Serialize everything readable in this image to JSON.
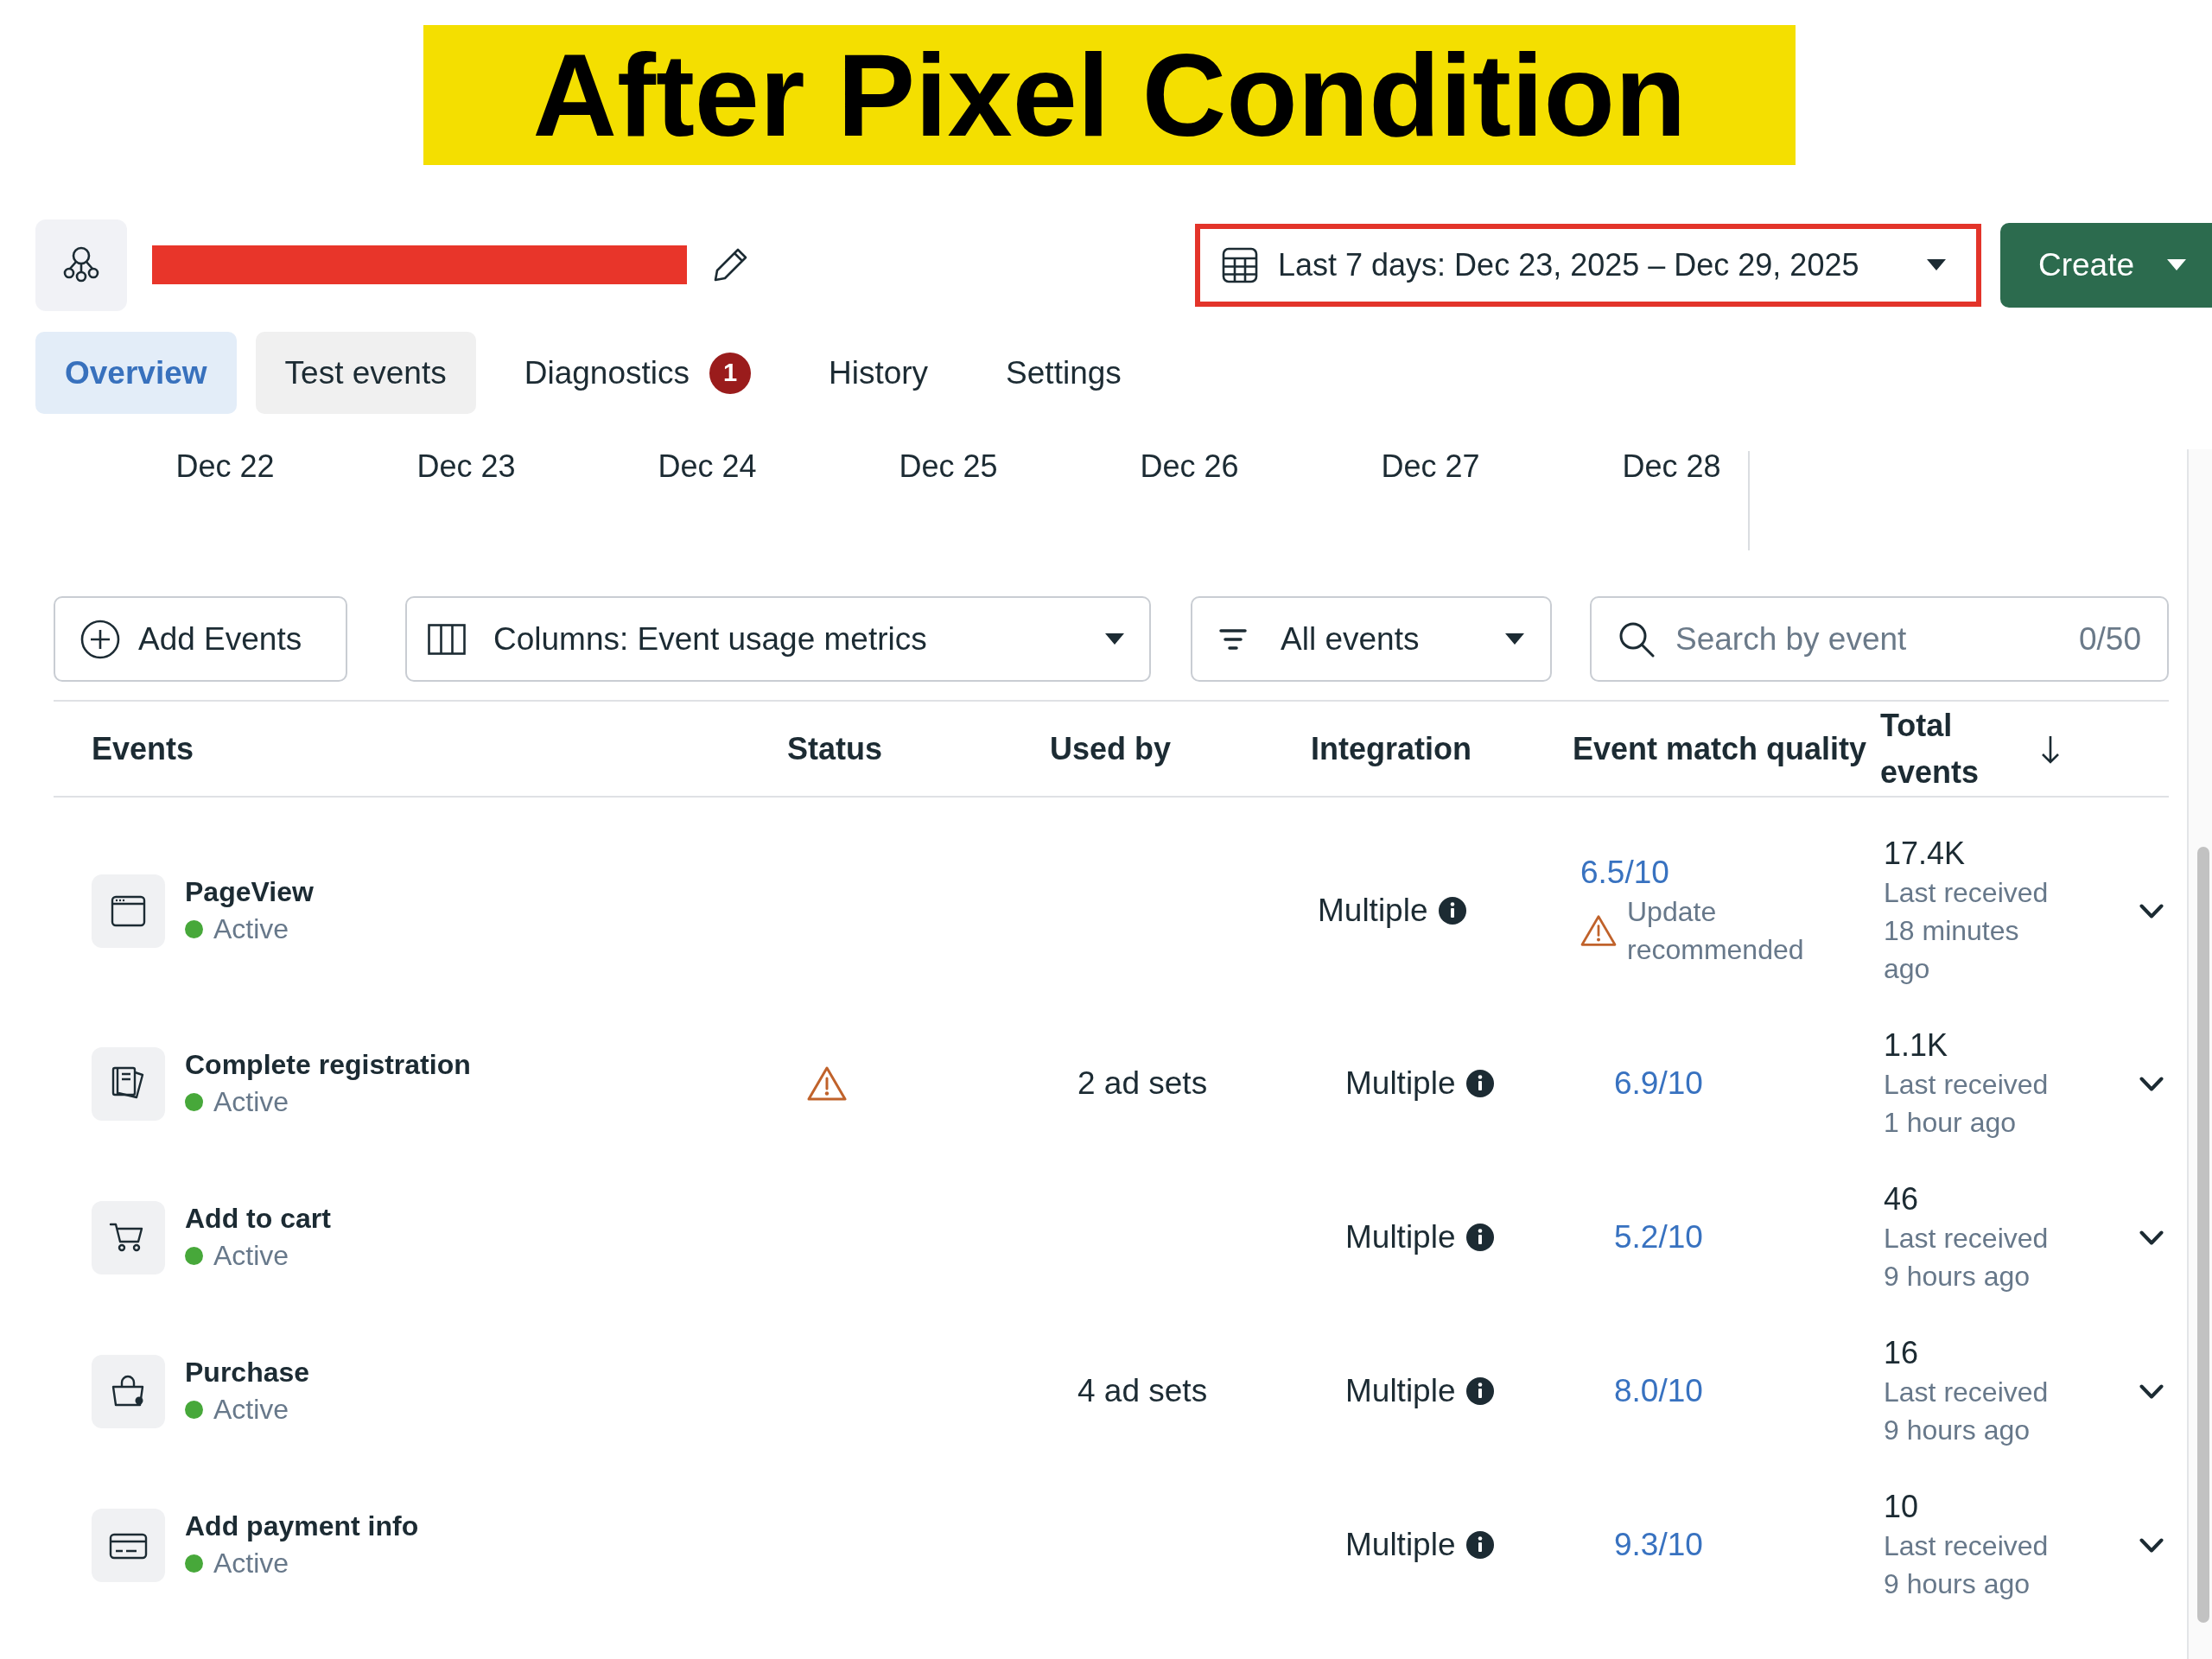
{
  "title": "After Pixel Condition",
  "header": {
    "name_redacted": true,
    "date_range": {
      "label": "Last 7 days: Dec 23, 2025 – Dec 29, 2025",
      "annotated": true
    },
    "create_button": {
      "label": "Create"
    }
  },
  "tabs": [
    {
      "label": "Overview",
      "selected": true,
      "hovered": false
    },
    {
      "label": "Test events",
      "selected": false,
      "hovered": true
    },
    {
      "label": "Diagnostics",
      "selected": false,
      "hovered": false,
      "badge": "1"
    },
    {
      "label": "History",
      "selected": false,
      "hovered": false
    },
    {
      "label": "Settings",
      "selected": false,
      "hovered": false
    }
  ],
  "date_axis": {
    "labels": [
      "Dec 22",
      "Dec 23",
      "Dec 24",
      "Dec 25",
      "Dec 26",
      "Dec 27",
      "Dec 28"
    ]
  },
  "toolbar": {
    "add_button": {
      "label": "Add Events"
    },
    "columns_dropdown": {
      "label": "Columns: Event usage metrics"
    },
    "filter_dropdown": {
      "label": "All events"
    },
    "search": {
      "placeholder": "Search by event",
      "counter": "0/50"
    }
  },
  "table": {
    "columns": [
      {
        "label": "Events",
        "sorted": false
      },
      {
        "label": "Status",
        "sorted": false
      },
      {
        "label": "Used by",
        "sorted": false
      },
      {
        "label": "Integration",
        "sorted": false
      },
      {
        "label": "Event match quality",
        "sorted": false
      },
      {
        "label": "Total events",
        "sorted": true
      }
    ],
    "rows": [
      {
        "kind": "page",
        "name": "PageView",
        "status": "Active",
        "color": "#47a83a",
        "status_warning": false,
        "integration": "Multiple",
        "emq_score": "6.5/10",
        "emq_note": "Update recommended",
        "total": "17.4K",
        "last_received": "Last received 18 minutes ago",
        "expanded": false
      },
      {
        "kind": "registration",
        "name": "Complete registration",
        "status": "Active",
        "color": "#47a83a",
        "status_warning": true,
        "used_by": "2 ad sets",
        "integration": "Multiple",
        "emq_score": "6.9/10",
        "total": "1.1K",
        "last_received": "Last received 1 hour ago",
        "expanded": false
      },
      {
        "kind": "cart",
        "name": "Add to cart",
        "status": "Active",
        "color": "#47a83a",
        "status_warning": false,
        "integration": "Multiple",
        "emq_score": "5.2/10",
        "total": "46",
        "last_received": "Last received 9 hours ago",
        "expanded": false
      },
      {
        "kind": "purchase",
        "name": "Purchase",
        "status": "Active",
        "color": "#47a83a",
        "status_warning": false,
        "used_by": "4 ad sets",
        "integration": "Multiple",
        "emq_score": "8.0/10",
        "total": "16",
        "last_received": "Last received 9 hours ago",
        "expanded": false
      },
      {
        "kind": "payment",
        "name": "Add payment info",
        "status": "Active",
        "color": "#47a83a",
        "status_warning": false,
        "integration": "Multiple",
        "emq_score": "9.3/10",
        "total": "10",
        "last_received": "Last received 9 hours ago",
        "expanded": false
      }
    ]
  }
}
